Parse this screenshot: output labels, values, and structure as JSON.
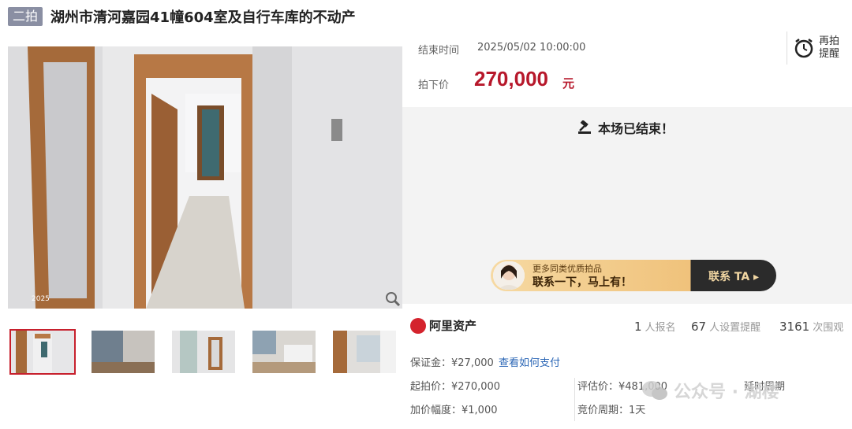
{
  "header": {
    "badge": "二拍",
    "title": "湖州市清河嘉园41幢604室及自行车库的不动产"
  },
  "auction": {
    "end_time_label": "结束时间",
    "end_time_value": "2025/05/02 10:00:00",
    "price_label": "拍下价",
    "price_value": "270,000",
    "price_unit": "元",
    "remind_label": "再拍提醒",
    "ended_text": "本场已结束！"
  },
  "promo": {
    "line1": "更多同类优质拍品",
    "line2": "联系一下，马上有！",
    "button": "联系 TA ▸"
  },
  "stats": {
    "brand": "阿里资产",
    "signups_value": "1",
    "signups_label": "人报名",
    "reminders_value": "67",
    "reminders_label": "人设置提醒",
    "views_value": "3161",
    "views_label": "次围观"
  },
  "details": {
    "deposit": "保证金：¥27,000",
    "deposit_link": "查看如何支付",
    "start_price": "起拍价：¥270,000",
    "appraisal": "评估价：¥481,000",
    "increment": "加价幅度：¥1,000",
    "cycle": "竞价周期：1天",
    "delay": "延时周期"
  },
  "watermark": {
    "text": "公众号 · 湖楼"
  },
  "image_stamp": "2025"
}
